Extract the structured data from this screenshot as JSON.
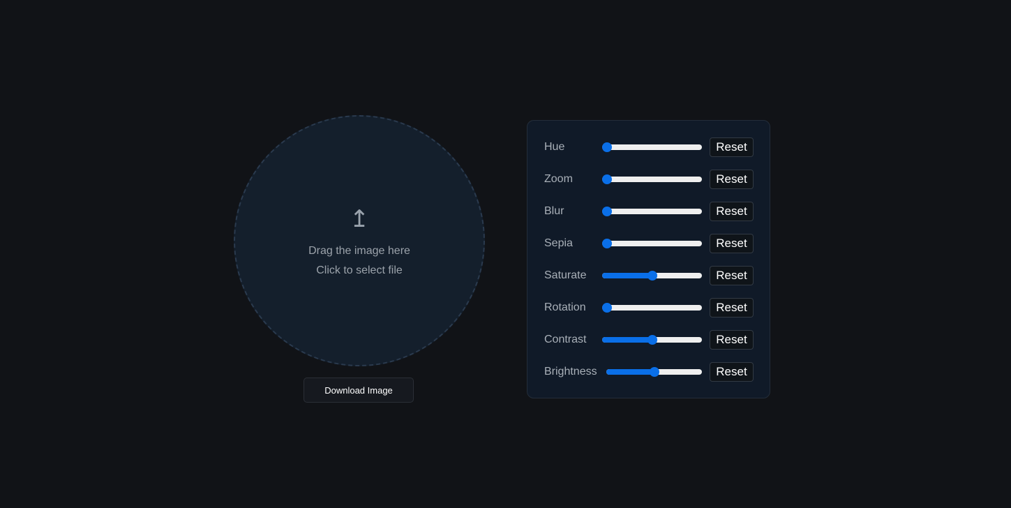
{
  "dropzone": {
    "icon": "upload-arrow-icon",
    "icon_glyph": "↥",
    "line1": "Drag the image here",
    "line2": "Click to select file"
  },
  "download_label": "Download Image",
  "controls": [
    {
      "label": "Hue",
      "value": 0,
      "reset_label": "Reset"
    },
    {
      "label": "Zoom",
      "value": 0,
      "reset_label": "Reset"
    },
    {
      "label": "Blur",
      "value": 0,
      "reset_label": "Reset"
    },
    {
      "label": "Sepia",
      "value": 0,
      "reset_label": "Reset"
    },
    {
      "label": "Saturate",
      "value": 0.5,
      "reset_label": "Reset"
    },
    {
      "label": "Rotation",
      "value": 0,
      "reset_label": "Reset"
    },
    {
      "label": "Contrast",
      "value": 0.5,
      "reset_label": "Reset"
    },
    {
      "label": "Brightness",
      "value": 0.5,
      "reset_label": "Reset"
    }
  ],
  "colors": {
    "accent": "#0a6fe8",
    "background": "#111317",
    "panel": "#101a28",
    "dropzone": "#141f2c"
  }
}
